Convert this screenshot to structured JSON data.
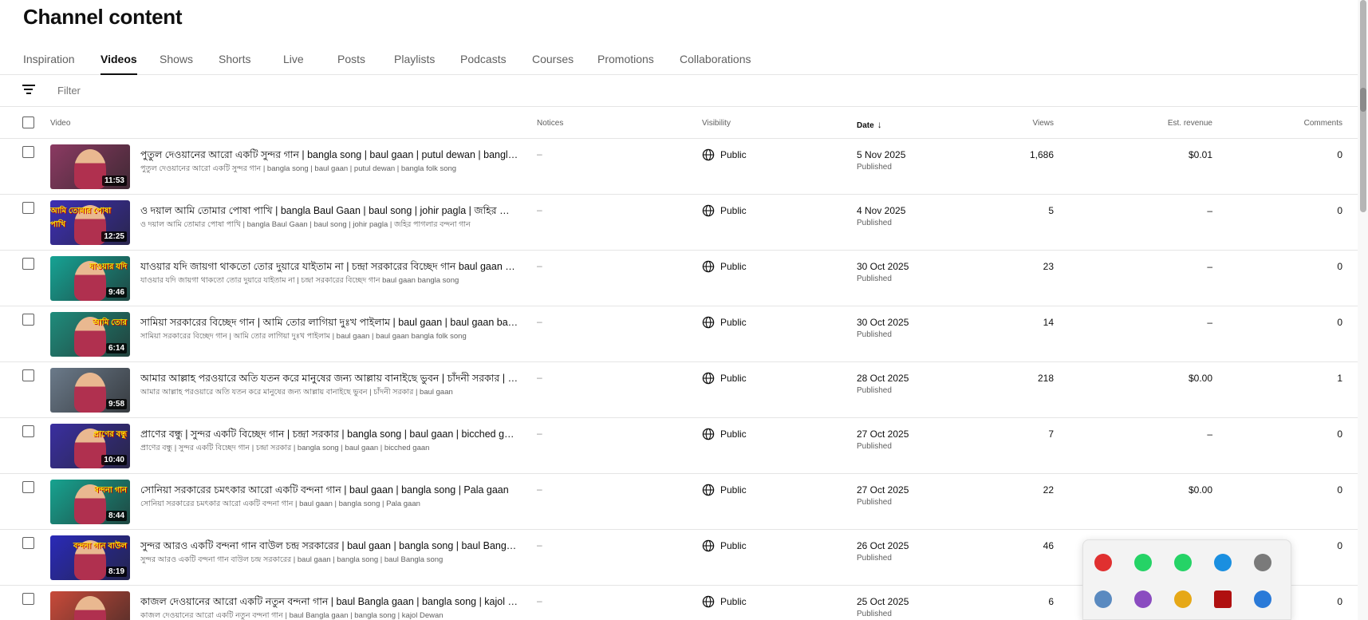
{
  "page": {
    "title": "Channel content"
  },
  "tabs": [
    "Inspiration",
    "Videos",
    "Shows",
    "Shorts",
    "Live",
    "Posts",
    "Playlists",
    "Podcasts",
    "Courses",
    "Promotions",
    "Collaborations"
  ],
  "active_tab": "Videos",
  "filter": {
    "placeholder": "Filter"
  },
  "columns": {
    "video": "Video",
    "notices": "Notices",
    "visibility": "Visibility",
    "date": "Date",
    "views": "Views",
    "revenue": "Est. revenue",
    "comments": "Comments"
  },
  "rows": [
    {
      "title": "পুতুল দেওয়ানের আরো একটি সুন্দর গান | bangla song | baul gaan | putul dewan | bangla folk...",
      "desc": "পুতুল দেওয়ানের আরো একটি সুন্দর গান | bangla song | baul gaan | putul dewan | bangla folk song",
      "duration": "11:53",
      "notices": "–",
      "visibility": "Public",
      "date": "5 Nov 2025",
      "status": "Published",
      "views": "1,686",
      "revenue": "$0.01",
      "comments": "0"
    },
    {
      "title": "ও দয়াল আমি তোমার পোষা পাখি | bangla Baul Gaan | baul song | johir pagla | জহির পাগলার ...",
      "desc": "ও দয়াল আমি তোমার পোষা পাখি | bangla Baul Gaan | baul song | johir pagla | জহির পাগলার বন্দনা গান",
      "duration": "12:25",
      "notices": "–",
      "visibility": "Public",
      "date": "4 Nov 2025",
      "status": "Published",
      "views": "5",
      "revenue": "–",
      "comments": "0"
    },
    {
      "title": "যাওয়ার যদি জায়গা থাকতো তোর দুয়ারে যাইতাম না | চন্দ্রা সরকারের বিচ্ছেদ গান baul gaan ban...",
      "desc": "যাওয়ার যদি জায়গা থাকতো তোর দুয়ারে যাইতাম না | চন্দ্রা সরকারের বিচ্ছেদ গান baul gaan bangla song",
      "duration": "9:46",
      "notices": "–",
      "visibility": "Public",
      "date": "30 Oct 2025",
      "status": "Published",
      "views": "23",
      "revenue": "–",
      "comments": "0"
    },
    {
      "title": "সামিয়া সরকারের বিচ্ছেদ গান | আমি তোর লাগিয়া দুঃখ পাইলাম | baul gaan | baul gaan bangla...",
      "desc": "সামিয়া সরকারের বিচ্ছেদ গান | আমি তোর লাগিয়া দুঃখ পাইলাম | baul gaan | baul gaan bangla folk song",
      "duration": "6:14",
      "notices": "–",
      "visibility": "Public",
      "date": "30 Oct 2025",
      "status": "Published",
      "views": "14",
      "revenue": "–",
      "comments": "0"
    },
    {
      "title": "আমার আল্লাহ পরওয়ারে অতি যতন করে মানুষের জন্য আল্লায় বানাইছে ভুবন | চাঁদনী সরকার | b...",
      "desc": "আমার আল্লাহ পরওয়ারে অতি যতন করে মানুষের জন্য আল্লায় বানাইছে ভুবন | চাঁদনী সরকার | baul gaan",
      "duration": "9:58",
      "notices": "–",
      "visibility": "Public",
      "date": "28 Oct 2025",
      "status": "Published",
      "views": "218",
      "revenue": "$0.00",
      "comments": "1"
    },
    {
      "title": "প্রাণের বন্ধু | সুন্দর একটি বিচ্ছেদ গান | চন্দ্রা সরকার | bangla song | baul gaan | bicched gaan",
      "desc": "প্রাণের বন্ধু | সুন্দর একটি বিচ্ছেদ গান | চন্দ্রা সরকার | bangla song | baul gaan | bicched gaan",
      "duration": "10:40",
      "notices": "–",
      "visibility": "Public",
      "date": "27 Oct 2025",
      "status": "Published",
      "views": "7",
      "revenue": "–",
      "comments": "0"
    },
    {
      "title": "সোনিয়া সরকারের চমৎকার আরো একটি বন্দনা গান | baul gaan | bangla song | Pala gaan",
      "desc": "সোনিয়া সরকারের চমৎকার আরো একটি বন্দনা গান | baul gaan | bangla song | Pala gaan",
      "duration": "8:44",
      "notices": "–",
      "visibility": "Public",
      "date": "27 Oct 2025",
      "status": "Published",
      "views": "22",
      "revenue": "$0.00",
      "comments": "0"
    },
    {
      "title": "সুন্দর আরও একটি বন্দনা গান বাউল চন্দ্র সরকারের | baul gaan | bangla song | baul Bangla so...",
      "desc": "সুন্দর আরও একটি বন্দনা গান বাউল চন্দ্র সরকারের | baul gaan | bangla song | baul Bangla song",
      "duration": "8:19",
      "notices": "–",
      "visibility": "Public",
      "date": "26 Oct 2025",
      "status": "Published",
      "views": "46",
      "revenue": "",
      "comments": "0"
    },
    {
      "title": "কাজল দেওয়ানের আরো একটি নতুন বন্দনা গান | baul Bangla gaan | bangla song | kajol Dew...",
      "desc": "কাজল দেওয়ানের আরো একটি নতুন বন্দনা গান | baul Bangla gaan | bangla song | kajol Dewan",
      "duration": "",
      "notices": "–",
      "visibility": "Public",
      "date": "25 Oct 2025",
      "status": "Published",
      "views": "6",
      "revenue": "",
      "comments": "0"
    }
  ],
  "thumb_colors": [
    "#8b3a62",
    "#3d2fb5",
    "#16a394",
    "#1f8c7c",
    "#6b7a8a",
    "#3a2fa0",
    "#17a390",
    "#2a2ab8",
    "#c84a3a"
  ],
  "thumb_overlays": [
    "",
    "আমি তোমার পোষা পাখি",
    "যাওয়ার যদি",
    "আমি তোর",
    "",
    "প্রাণের বন্ধু",
    "বন্দনা গান",
    "বন্দনা গান বাউল",
    ""
  ],
  "tray_icons": [
    "telegram-icon",
    "whatsapp-icon",
    "whatsapp-business-icon",
    "edge-icon",
    "webcam-icon",
    "onedrive-icon",
    "feather-icon",
    "chrome-icon",
    "acrobat-icon",
    "windows-security-icon"
  ]
}
